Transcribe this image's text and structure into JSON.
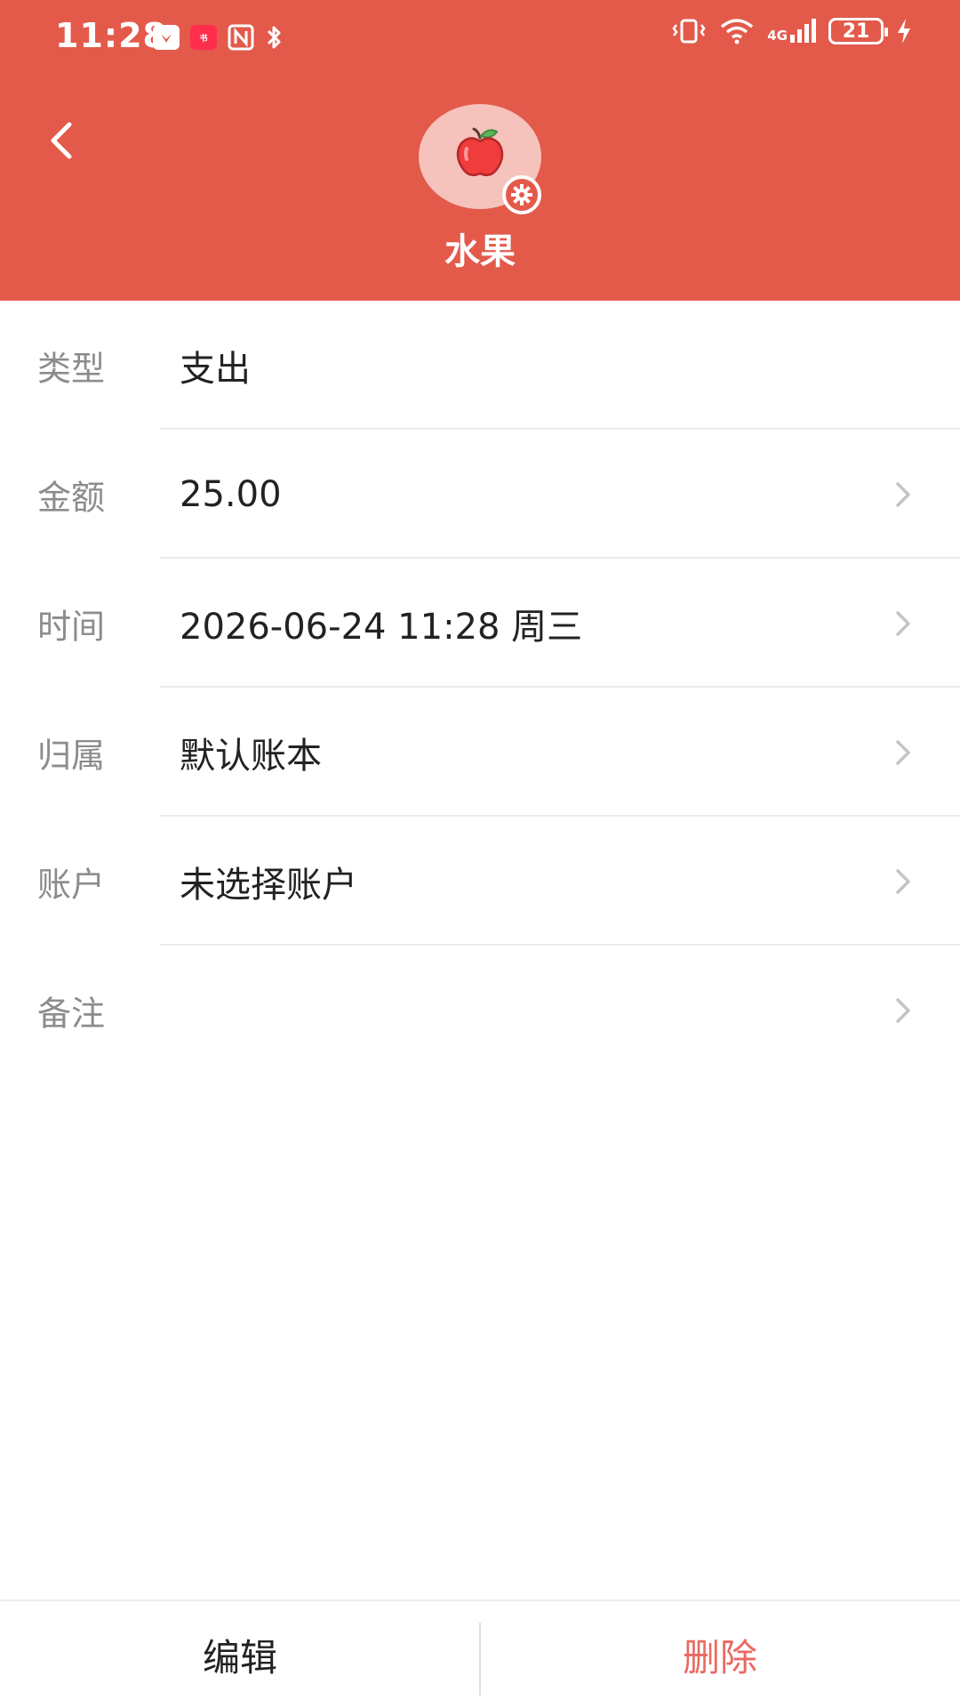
{
  "status_bar": {
    "time": "11:28",
    "app_badges": [
      "HUAWEI",
      "小红书"
    ],
    "network": "4G",
    "battery": "21"
  },
  "header": {
    "back_icon": "chevron-left-icon",
    "category_icon": "apple-icon",
    "settings_icon": "gear-icon",
    "category_name": "水果",
    "background_color": "#E35A4B"
  },
  "details": [
    {
      "label": "类型",
      "value": "支出",
      "has_chevron": false
    },
    {
      "label": "金额",
      "value": "25.00",
      "has_chevron": true
    },
    {
      "label": "时间",
      "value": "2026-06-24 11:28 周三",
      "has_chevron": true
    },
    {
      "label": "归属",
      "value": "默认账本",
      "has_chevron": true
    },
    {
      "label": "账户",
      "value": "未选择账户",
      "has_chevron": true
    },
    {
      "label": "备注",
      "value": "",
      "has_chevron": true
    }
  ],
  "bottom_bar": {
    "edit_label": "编辑",
    "delete_label": "删除",
    "delete_color": "#E96A62"
  }
}
